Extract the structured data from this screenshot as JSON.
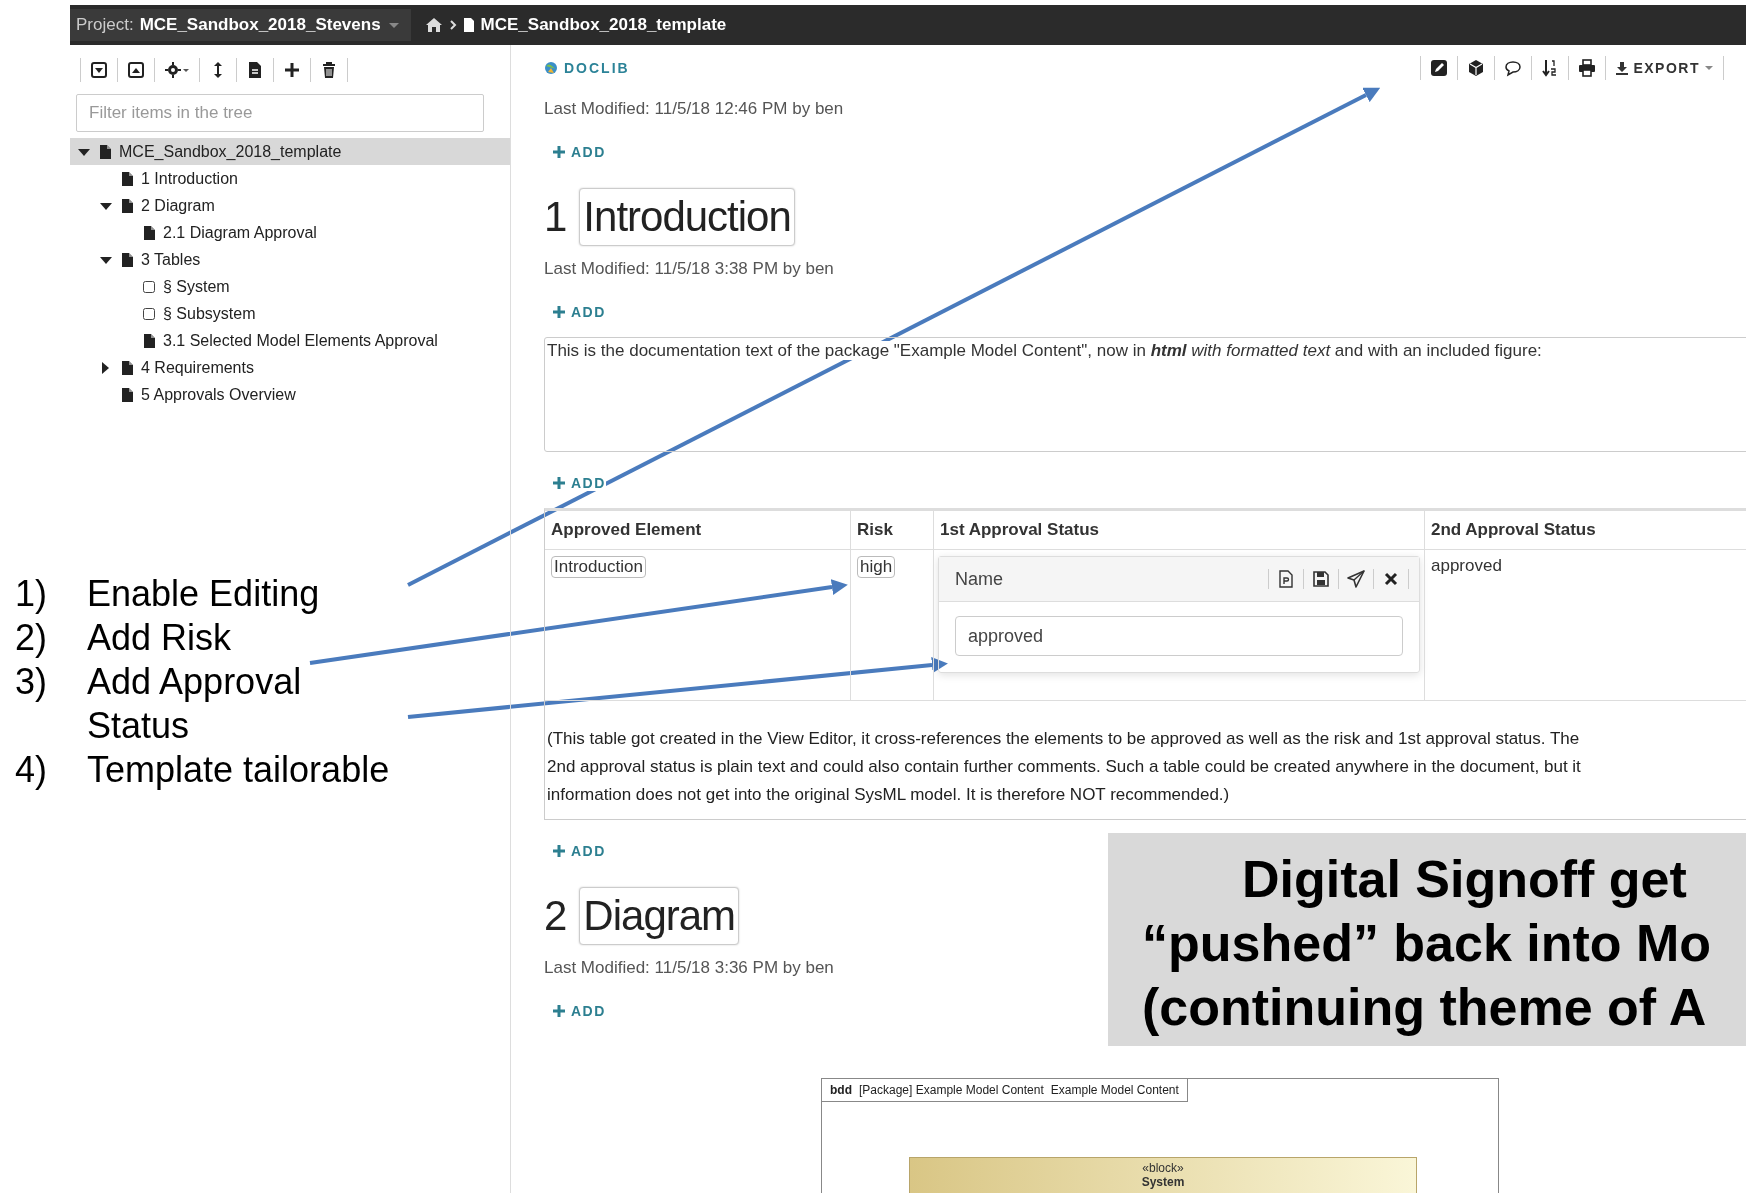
{
  "project_bar": {
    "label": "Project:",
    "project": "MCE_Sandbox_2018_Stevens",
    "breadcrumb": "MCE_Sandbox_2018_template"
  },
  "sidebar": {
    "filter": {
      "placeholder": "Filter items in the tree"
    },
    "tree": [
      {
        "label": "MCE_Sandbox_2018_template",
        "kind": "document",
        "expanded": true,
        "selected": true,
        "children": [
          {
            "label": "1 Introduction",
            "kind": "document",
            "selected": false
          },
          {
            "label": "2 Diagram",
            "kind": "document",
            "expanded": true,
            "selected": false,
            "children": [
              {
                "label": "2.1 Diagram Approval",
                "kind": "document",
                "selected": false
              }
            ]
          },
          {
            "label": "3 Tables",
            "kind": "document",
            "expanded": true,
            "selected": false,
            "children": [
              {
                "label": "§ System",
                "kind": "section",
                "selected": false
              },
              {
                "label": "§ Subsystem",
                "kind": "section",
                "selected": false
              },
              {
                "label": "3.1 Selected Model Elements Approval",
                "kind": "document",
                "selected": false
              }
            ]
          },
          {
            "label": "4 Requirements",
            "kind": "document",
            "expanded": false,
            "selected": false
          },
          {
            "label": "5 Approvals Overview",
            "kind": "document",
            "selected": false
          }
        ]
      }
    ]
  },
  "main": {
    "brand": "DOCLIB",
    "export": "EXPORT",
    "content": [
      {
        "kind": "modified",
        "text": "Last Modified: 11/5/18 12:46 PM by ben"
      },
      {
        "kind": "add",
        "label": "ADD"
      },
      {
        "kind": "heading",
        "number": "1",
        "title": "Introduction"
      },
      {
        "kind": "modified",
        "text": "Last Modified: 11/5/18 3:38 PM by ben"
      },
      {
        "kind": "add",
        "label": "ADD"
      },
      {
        "kind": "doc_text",
        "text": "This is the documentation text of the package \"Example Model Content\", now in **html** *with formatted text* and with an included figure:"
      },
      {
        "kind": "add",
        "label": "ADD"
      },
      {
        "kind": "table",
        "columns": [
          "Approved Element",
          "Risk",
          "1st Approval Status",
          "2nd Approval Status"
        ],
        "rows": [
          [
            {
              "kind": "reference",
              "text": "Introduction"
            },
            {
              "kind": "reference",
              "text": "high"
            },
            {
              "kind": "editor",
              "title": "Name",
              "value": "approved"
            },
            {
              "kind": "plain",
              "text": "approved"
            }
          ]
        ],
        "caption": "(This table got created in the View Editor, it cross-references the elements to be approved as well as the risk and 1st approval status. The\n2nd approval status is plain text and could also contain further comments. Such a table could be created anywhere in the document, but it\ninformation does not get into the original SysML model. It is therefore NOT recommended.)"
      },
      {
        "kind": "add",
        "label": "ADD"
      },
      {
        "kind": "heading",
        "number": "2",
        "title": "Diagram"
      },
      {
        "kind": "modified",
        "text": "Last Modified: 11/5/18 3:36 PM by ben"
      },
      {
        "kind": "add",
        "label": "ADD"
      },
      {
        "kind": "figure",
        "type_label": "bdd",
        "title": "[Package] Example Model Content",
        "title_2": "Example Model Content",
        "stereotype": "«block»",
        "block_name": "System"
      }
    ]
  },
  "annotations": [
    {
      "number": "1)",
      "text": "Enable Editing"
    },
    {
      "number": "2)",
      "text": "Add Risk"
    },
    {
      "number": "3)",
      "text": "Add Approval Status"
    },
    {
      "number": "4)",
      "text": "Template tailorable"
    }
  ],
  "callout": {
    "lines": [
      "Digital Signoff get",
      "“pushed” back into Mo",
      "(continuing theme of A"
    ]
  }
}
